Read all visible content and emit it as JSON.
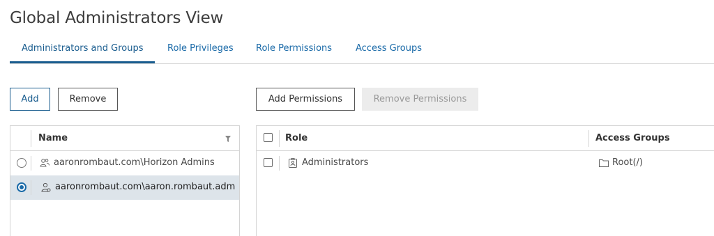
{
  "page": {
    "title": "Global Administrators View"
  },
  "tabs": [
    {
      "label": "Administrators and Groups",
      "active": true
    },
    {
      "label": "Role Privileges",
      "active": false
    },
    {
      "label": "Role Permissions",
      "active": false
    },
    {
      "label": "Access Groups",
      "active": false
    }
  ],
  "left_toolbar": {
    "add_label": "Add",
    "remove_label": "Remove"
  },
  "right_toolbar": {
    "add_permissions_label": "Add Permissions",
    "remove_permissions_label": "Remove Permissions"
  },
  "admins_grid": {
    "columns": [
      {
        "label": "Name"
      }
    ],
    "rows": [
      {
        "name": "aaronrombaut.com\\Horizon Admins",
        "icon": "user-group-icon",
        "selected": false
      },
      {
        "name": "aaronrombaut.com\\aaron.rombaut.adm",
        "icon": "user-icon",
        "selected": true
      }
    ]
  },
  "permissions_grid": {
    "columns": [
      {
        "label": "Role"
      },
      {
        "label": "Access Groups"
      }
    ],
    "rows": [
      {
        "role": "Administrators",
        "role_icon": "id-badge-icon",
        "access_group": "Root(/)",
        "access_group_icon": "folder-icon"
      }
    ]
  },
  "colors": {
    "accent": "#1a5d8f",
    "link": "#1a6aa8",
    "selected_row": "#dde4ea",
    "border": "#d4d4d4"
  }
}
